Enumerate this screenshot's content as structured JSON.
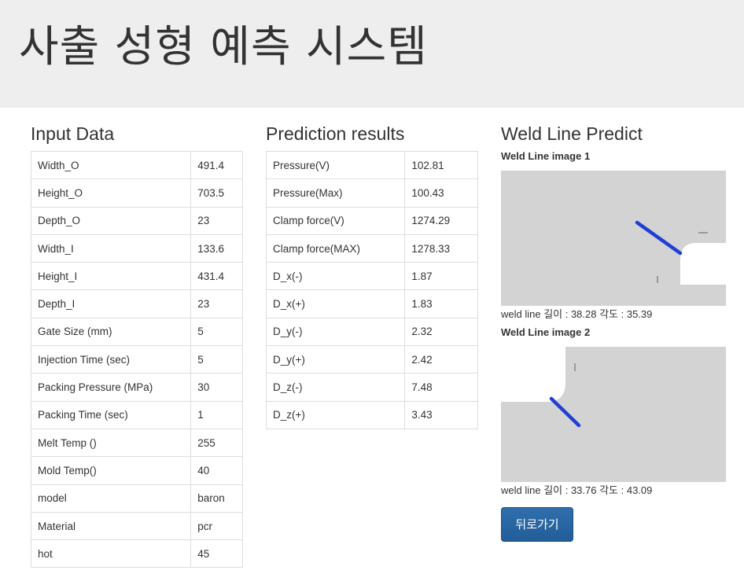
{
  "page_title": "사출 성형 예측 시스템",
  "input": {
    "heading": "Input Data",
    "rows": [
      {
        "label": "Width_O",
        "value": "491.4"
      },
      {
        "label": "Height_O",
        "value": "703.5"
      },
      {
        "label": "Depth_O",
        "value": "23"
      },
      {
        "label": "Width_I",
        "value": "133.6"
      },
      {
        "label": "Height_I",
        "value": "431.4"
      },
      {
        "label": "Depth_I",
        "value": "23"
      },
      {
        "label": "Gate Size (mm)",
        "value": "5"
      },
      {
        "label": "Injection Time (sec)",
        "value": "5"
      },
      {
        "label": "Packing Pressure (MPa)",
        "value": "30"
      },
      {
        "label": "Packing Time (sec)",
        "value": "1"
      },
      {
        "label": "Melt Temp ()",
        "value": "255"
      },
      {
        "label": "Mold Temp()",
        "value": "40"
      },
      {
        "label": "model",
        "value": "baron"
      },
      {
        "label": "Material",
        "value": "pcr"
      },
      {
        "label": "hot",
        "value": "45"
      }
    ]
  },
  "prediction": {
    "heading": "Prediction results",
    "rows": [
      {
        "label": "Pressure(V)",
        "value": "102.81"
      },
      {
        "label": "Pressure(Max)",
        "value": "100.43"
      },
      {
        "label": "Clamp force(V)",
        "value": "1274.29"
      },
      {
        "label": "Clamp force(MAX)",
        "value": "1278.33"
      },
      {
        "label": "D_x(-)",
        "value": "1.87"
      },
      {
        "label": "D_x(+)",
        "value": "1.83"
      },
      {
        "label": "D_y(-)",
        "value": "2.32"
      },
      {
        "label": "D_y(+)",
        "value": "2.42"
      },
      {
        "label": "D_z(-)",
        "value": "7.48"
      },
      {
        "label": "D_z(+)",
        "value": "3.43"
      }
    ]
  },
  "weld": {
    "heading": "Weld Line Predict",
    "images": [
      {
        "title": "Weld Line image 1",
        "caption": "weld line 길이 : 38.28 각도 : 35.39"
      },
      {
        "title": "Weld Line image 2",
        "caption": "weld line 길이 : 33.76 각도 : 43.09"
      }
    ],
    "colors": {
      "image_bg": "#d3d3d3",
      "weld_line": "#1f3fd6",
      "cutout": "#ffffff"
    }
  },
  "back_button": {
    "label": "뒤로가기",
    "color": "#2a6aa8"
  }
}
